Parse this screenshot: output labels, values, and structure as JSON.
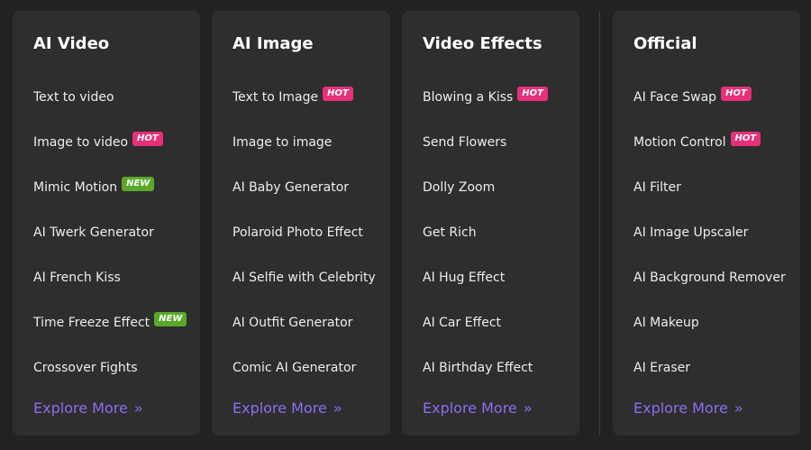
{
  "columns": [
    {
      "title": "AI Video",
      "items": [
        {
          "label": "Text to video",
          "badge": ""
        },
        {
          "label": "Image to video",
          "badge": "HOT"
        },
        {
          "label": "Mimic Motion",
          "badge": "NEW"
        },
        {
          "label": "AI Twerk Generator",
          "badge": ""
        },
        {
          "label": "AI French Kiss",
          "badge": ""
        },
        {
          "label": "Time Freeze Effect",
          "badge": "NEW"
        },
        {
          "label": "Crossover Fights",
          "badge": ""
        }
      ],
      "explore_label": "Explore More"
    },
    {
      "title": "AI Image",
      "items": [
        {
          "label": "Text to Image",
          "badge": "HOT"
        },
        {
          "label": "Image to image",
          "badge": ""
        },
        {
          "label": "AI Baby Generator",
          "badge": ""
        },
        {
          "label": "Polaroid Photo Effect",
          "badge": ""
        },
        {
          "label": "AI Selfie with Celebrity",
          "badge": ""
        },
        {
          "label": "AI Outfit Generator",
          "badge": ""
        },
        {
          "label": "Comic AI Generator",
          "badge": ""
        }
      ],
      "explore_label": "Explore More"
    },
    {
      "title": "Video Effects",
      "items": [
        {
          "label": "Blowing a Kiss",
          "badge": "HOT"
        },
        {
          "label": "Send Flowers",
          "badge": ""
        },
        {
          "label": "Dolly Zoom",
          "badge": ""
        },
        {
          "label": "Get Rich",
          "badge": ""
        },
        {
          "label": "AI Hug Effect",
          "badge": ""
        },
        {
          "label": "AI Car Effect",
          "badge": ""
        },
        {
          "label": "AI Birthday Effect",
          "badge": ""
        }
      ],
      "explore_label": "Explore More"
    },
    {
      "title": "Official",
      "items": [
        {
          "label": "AI Face Swap",
          "badge": "HOT"
        },
        {
          "label": "Motion Control",
          "badge": "HOT"
        },
        {
          "label": "AI Filter",
          "badge": ""
        },
        {
          "label": "AI Image Upscaler",
          "badge": ""
        },
        {
          "label": "AI Background Remover",
          "badge": ""
        },
        {
          "label": "AI Makeup",
          "badge": ""
        },
        {
          "label": "AI Eraser",
          "badge": ""
        }
      ],
      "explore_label": "Explore More"
    }
  ],
  "icons": {
    "explore": "double-chevron-right-icon"
  },
  "colors": {
    "page_background": "#222222",
    "card_background": "#2e2e2e",
    "title_text": "#ffffff",
    "item_text": "#ededed",
    "hot_badge": "#e6307a",
    "new_badge": "#5aa82a",
    "explore_link": "#8f6cf0"
  }
}
